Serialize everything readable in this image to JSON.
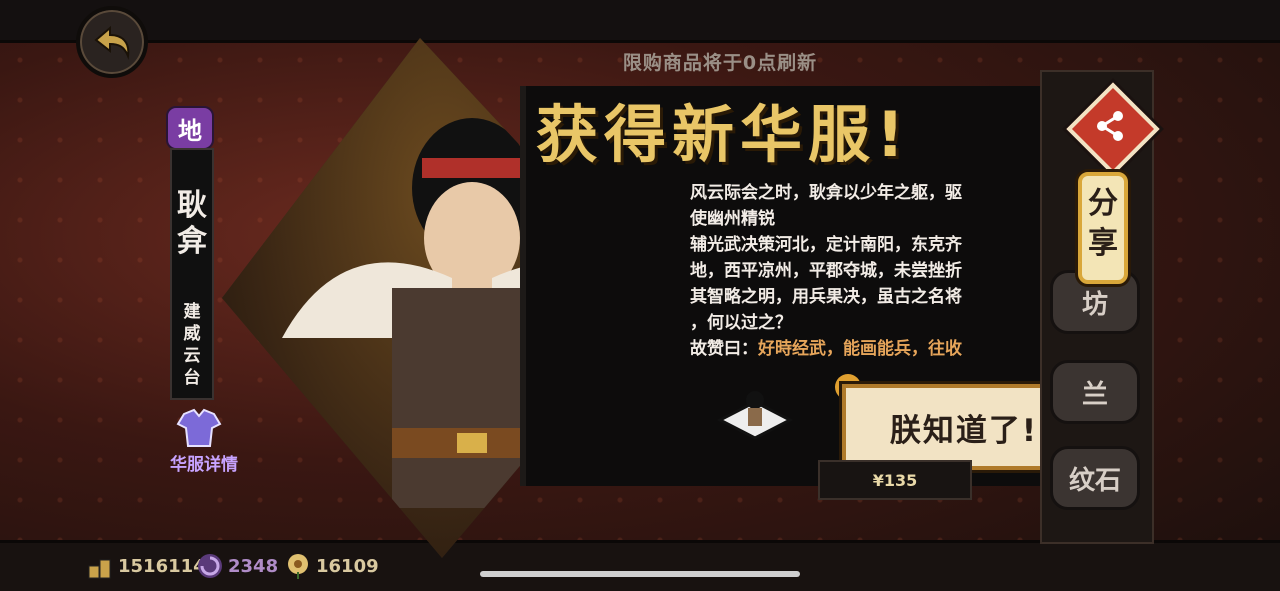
{
  "header": {
    "refresh_notice": "限购商品将于0点刷新"
  },
  "hero": {
    "rarity_badge": "地",
    "name_line1": "耿",
    "name_line2": "弇",
    "title_chars": [
      "建",
      "威",
      "云",
      "台"
    ],
    "outfit_detail_label": "华服详情"
  },
  "reward": {
    "headline": "获得新华服!",
    "story_lines": [
      "风云际会之时，耿弇以少年之躯，驱",
      "使幽州精锐",
      "辅光武决策河北，定计南阳，东克齐",
      "地，西平凉州，平郡夺城，未尝挫折",
      "其智略之明，用兵果决，虽古之名将",
      "，何以过之？"
    ],
    "praise_label": "故赞曰：",
    "praise_text": "好時经武，能画能兵，往收",
    "confirm_button": "朕知道了!"
  },
  "side_menu": {
    "share_button": "分享",
    "tabs": [
      "坊",
      "兰",
      "纹石"
    ]
  },
  "shop": {
    "price": "¥135"
  },
  "currencies": [
    {
      "icon": "gold-bars-icon",
      "value": "1516114",
      "color": "#d9c9a0"
    },
    {
      "icon": "purple-swirl-icon",
      "value": "2348",
      "color": "#b08cc8"
    },
    {
      "icon": "flower-icon",
      "value": "16109",
      "color": "#d9c9a0"
    }
  ],
  "colors": {
    "headline": "#e9c667",
    "praise": "#e6a55a",
    "rarity_badge": "#7a3da3",
    "share_icon_bg": "#c43a2a"
  }
}
